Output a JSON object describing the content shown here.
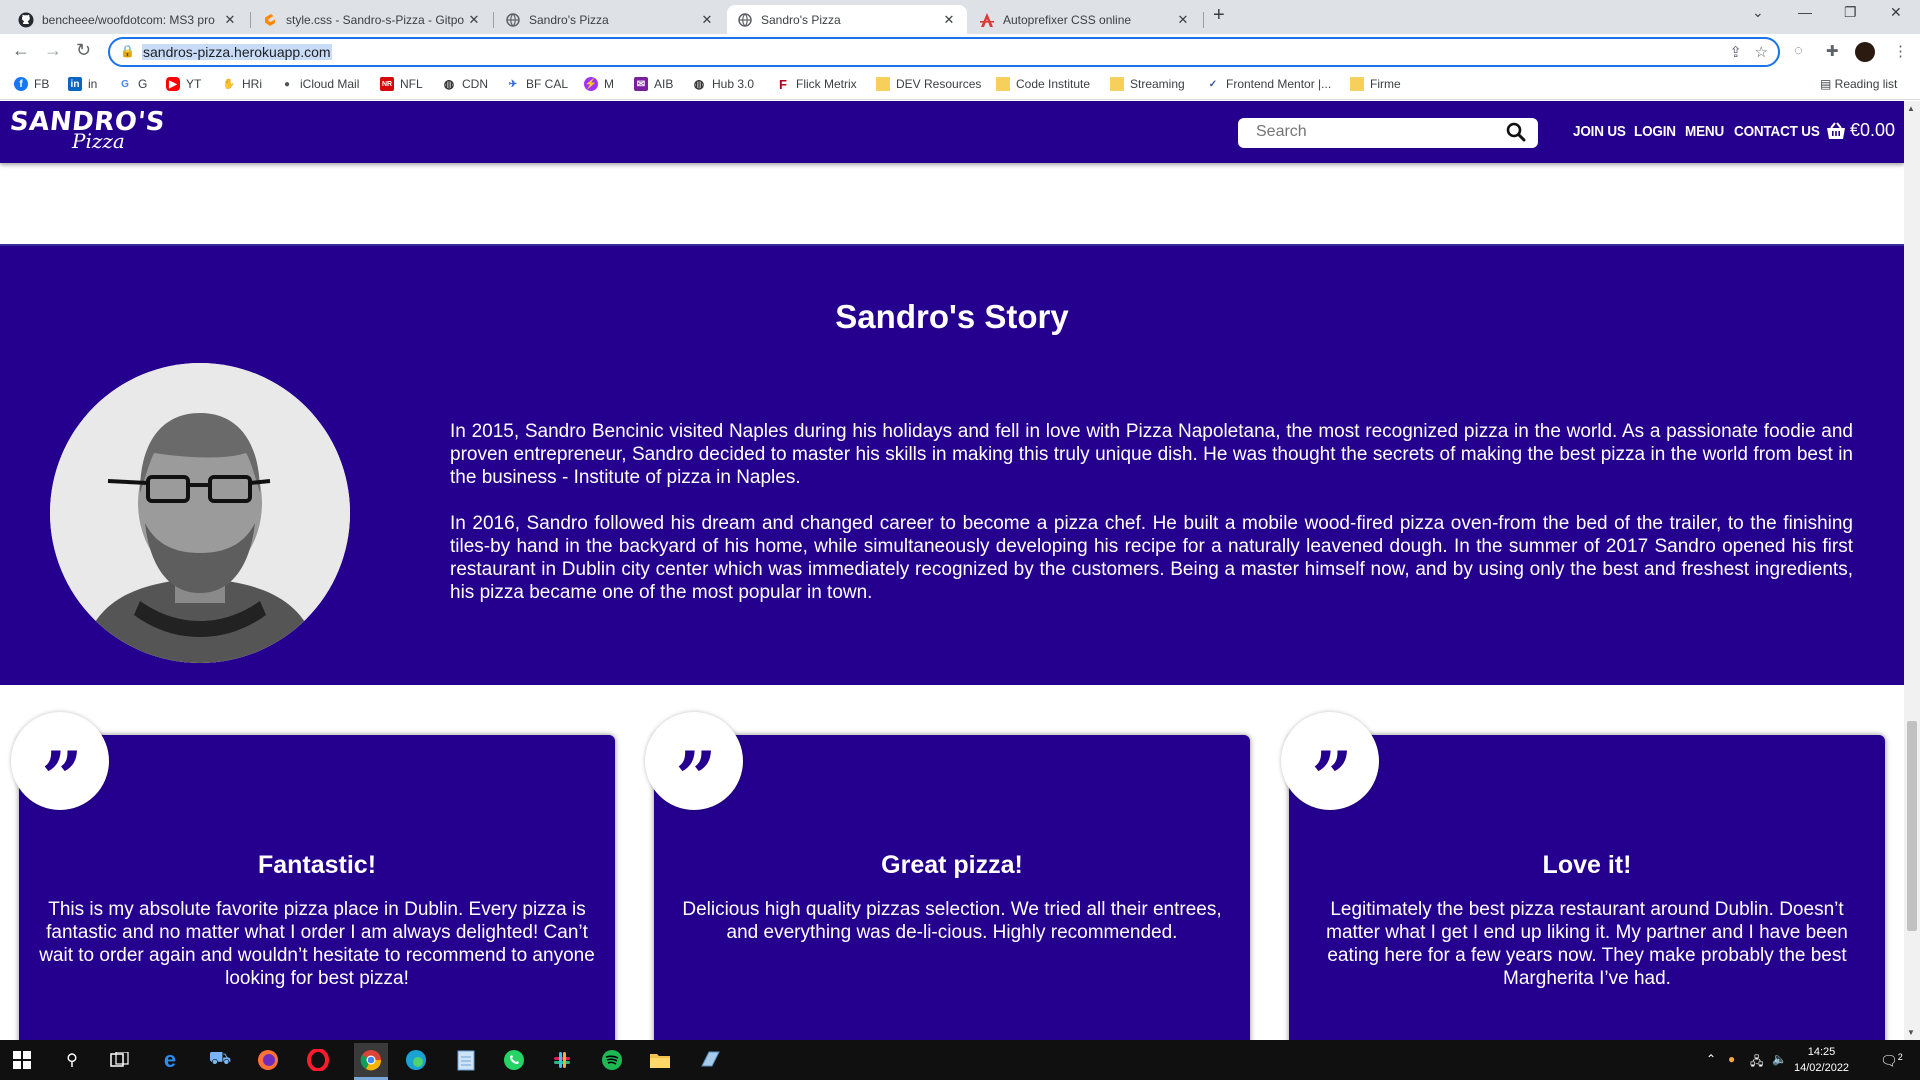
{
  "browser": {
    "tabs": [
      {
        "title": "bencheee/woofdotcom: MS3 pro",
        "icon": "github-icon",
        "active": false
      },
      {
        "title": "style.css - Sandro-s-Pizza - Gitpo",
        "icon": "gitpod-icon",
        "active": false
      },
      {
        "title": "Sandro's Pizza",
        "icon": "globe-icon",
        "active": false
      },
      {
        "title": "Sandro's Pizza",
        "icon": "globe-icon",
        "active": true
      },
      {
        "title": "Autoprefixer CSS online",
        "icon": "autoprefixer-icon",
        "active": false
      }
    ],
    "url": "sandros-pizza.herokuapp.com",
    "bookmarks": [
      {
        "label": "FB",
        "icon": "facebook-icon",
        "color": "#1877f2"
      },
      {
        "label": "in",
        "icon": "linkedin-icon",
        "color": "#0a66c2"
      },
      {
        "label": "G",
        "icon": "google-icon",
        "color": "#4285f4"
      },
      {
        "label": "YT",
        "icon": "youtube-icon",
        "color": "#ff0000"
      },
      {
        "label": "HRi",
        "icon": "hri-icon",
        "color": "#333333"
      },
      {
        "label": "iCloud Mail",
        "icon": "apple-icon",
        "color": "#555555"
      },
      {
        "label": "NFL",
        "icon": "nfl-icon",
        "color": "#d50a0a"
      },
      {
        "label": "CDN",
        "icon": "globe-icon",
        "color": "#333333"
      },
      {
        "label": "BF CAL",
        "icon": "bf-icon",
        "color": "#3367d6"
      },
      {
        "label": "M",
        "icon": "messenger-icon",
        "color": "#a033ff"
      },
      {
        "label": "AIB",
        "icon": "aib-icon",
        "color": "#7b1fa2"
      },
      {
        "label": "Hub 3.0",
        "icon": "globe-icon",
        "color": "#333333"
      },
      {
        "label": "Flick Metrix",
        "icon": "flick-icon",
        "color": "#b00020"
      },
      {
        "label": "DEV Resources",
        "icon": "folder-icon",
        "color": "#f6d05b"
      },
      {
        "label": "Code Institute",
        "icon": "folder-icon",
        "color": "#f6d05b"
      },
      {
        "label": "Streaming",
        "icon": "folder-icon",
        "color": "#f6d05b"
      },
      {
        "label": "Frontend Mentor |...",
        "icon": "frontend-mentor-icon",
        "color": "#3e54a3"
      },
      {
        "label": "Firme",
        "icon": "folder-icon",
        "color": "#f6d05b"
      }
    ],
    "reading_list": "Reading list"
  },
  "site": {
    "logo_line1": "SANDRO'S",
    "logo_line2": "Pizza",
    "search_placeholder": "Search",
    "nav": [
      "JOIN US",
      "LOGIN",
      "MENU",
      "CONTACT US"
    ],
    "cart_total": "€0.00",
    "brand_color": "#25008f",
    "story": {
      "title": "Sandro's Story",
      "paragraphs": [
        "In 2015, Sandro Bencinic visited Naples during his holidays and fell in love with Pizza Napoletana, the most recognized pizza in the world. As a passionate foodie and proven entrepreneur, Sandro decided to master his skills in making this truly unique dish. He was thought the secrets of making the best pizza in the world from best in the business - Institute of pizza in Naples.",
        "In 2016, Sandro followed his dream and changed career to become a pizza chef. He built a mobile wood-fired pizza oven-from the bed of the trailer, to the finishing tiles-by hand in the backyard of his home, while simultaneously developing his recipe for a naturally leavened dough. In the summer of 2017 Sandro opened his first restaurant in Dublin city center which was immediately recognized by the customers. Being a master himself now, and by using only the best and freshest ingredients, his pizza became one of the most popular in town."
      ]
    },
    "reviews": [
      {
        "quote_mark": "”",
        "title": "Fantastic!",
        "text": "This is my absolute favorite pizza place in Dublin. Every pizza is fantastic and no matter what I order I am always delighted! Can’t wait to order again and wouldn’t hesitate to recommend to anyone looking for best pizza!"
      },
      {
        "quote_mark": "”",
        "title": "Great pizza!",
        "text": "Delicious high quality pizzas selection. We tried all their entrees, and everything was de-li-cious. Highly recommended."
      },
      {
        "quote_mark": "”",
        "title": "Love it!",
        "text": "Legitimately the best pizza restaurant around Dublin. Doesn’t matter what I get I end up liking it. My partner and I have been eating here for a few years now. They make probably the best Margherita I’ve had."
      }
    ]
  },
  "taskbar": {
    "time": "14:25",
    "date": "14/02/2022",
    "notification_count": "2"
  }
}
